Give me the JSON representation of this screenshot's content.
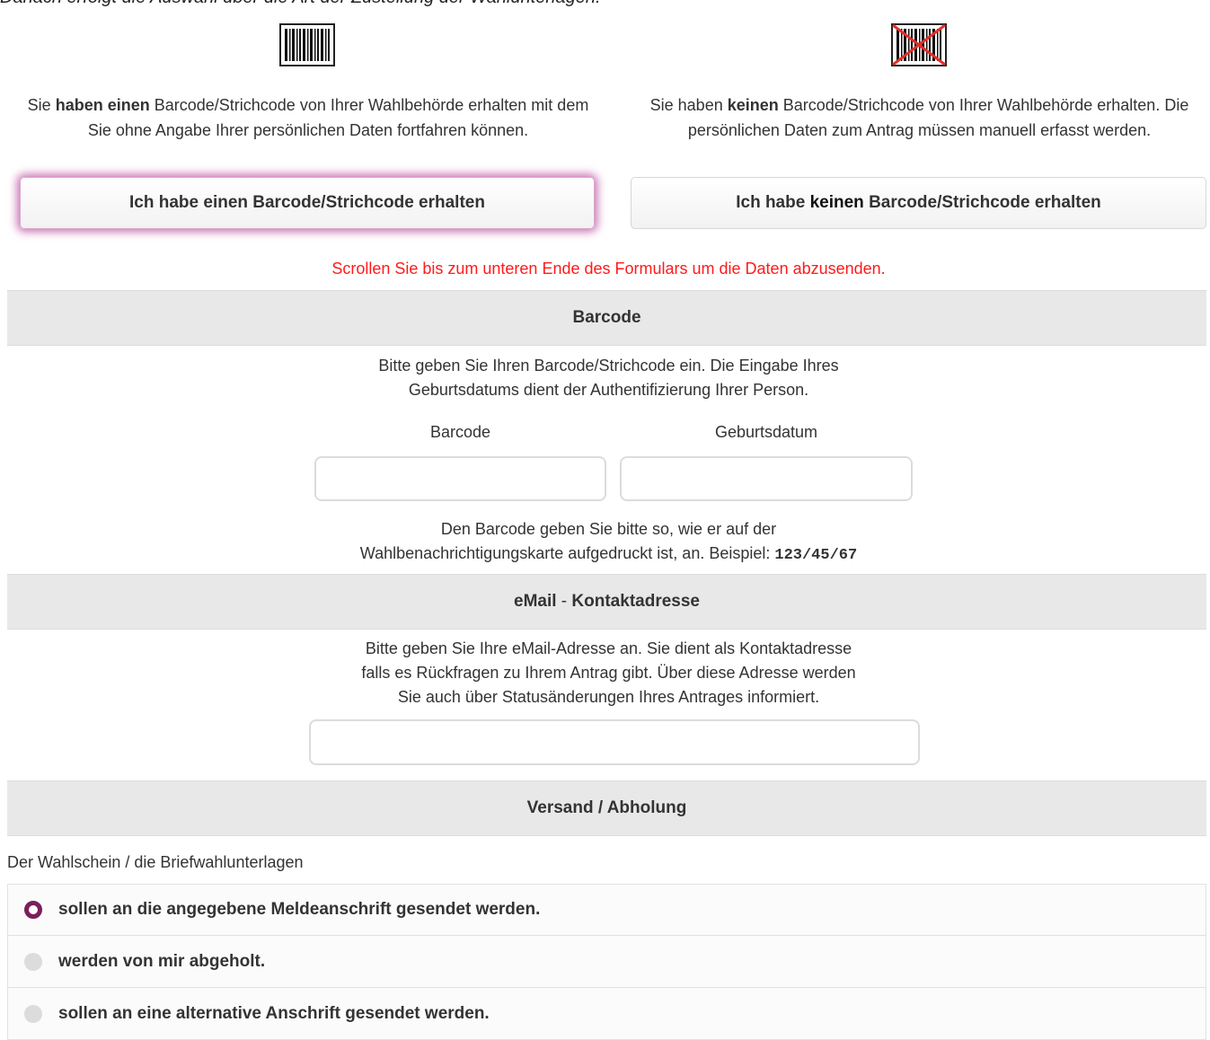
{
  "intro_text": "Danach erfolgt die Auswahl über die Art der Zustellung der Wahlunterlagen.",
  "options": {
    "with_barcode": {
      "icon": "barcode-icon",
      "desc_pre": "Sie ",
      "desc_bold": "haben einen",
      "desc_post": " Barcode/Strichcode von Ihrer Wahlbehörde erhalten mit dem Sie ohne Angabe Ihrer persönlichen Daten fortfahren können.",
      "button_label": "Ich habe einen Barcode/Strichcode erhalten"
    },
    "without_barcode": {
      "icon": "no-barcode-icon",
      "desc_pre": "Sie haben ",
      "desc_bold": "keinen",
      "desc_post": " Barcode/Strichcode von Ihrer Wahlbehörde erhalten. Die persönlichen Daten zum Antrag müssen manuell erfasst werden.",
      "button_pre": "Ich habe ",
      "button_bold": "keinen",
      "button_post": " Barcode/Strichcode erhalten"
    }
  },
  "scroll_hint": "Scrollen Sie bis zum unteren Ende des Formulars um die Daten abzusenden.",
  "barcode_section": {
    "title": "Barcode",
    "instruction_line1": "Bitte geben Sie Ihren Barcode/Strichcode ein. Die Eingabe Ihres",
    "instruction_line2": "Geburtsdatums dient der Authentifizierung Ihrer Person.",
    "barcode_label": "Barcode",
    "birthdate_label": "Geburtsdatum",
    "barcode_value": "",
    "birthdate_value": "",
    "hint_line1": "Den Barcode geben Sie bitte so, wie er auf der",
    "hint_line2": "Wahlbenachrichtigungskarte aufgedruckt ist, an. Beispiel: ",
    "example": "123/45/67"
  },
  "email_section": {
    "title_bold_a": "eMail",
    "title_thin": " - ",
    "title_bold_b": "Kontaktadresse",
    "instruction_line1": "Bitte geben Sie Ihre eMail-Adresse an. Sie dient als Kontaktadresse",
    "instruction_line2": "falls es Rückfragen zu Ihrem Antrag gibt. Über diese Adresse werden",
    "instruction_line3": "Sie auch über Statusänderungen Ihres Antrages informiert.",
    "email_value": ""
  },
  "delivery_section": {
    "title": "Versand / Abholung",
    "label": "Der Wahlschein / die Briefwahlunterlagen",
    "options": [
      {
        "label": "sollen an die angegebene Meldeanschrift gesendet werden.",
        "selected": true
      },
      {
        "label": "werden von mir abgeholt.",
        "selected": false
      },
      {
        "label": "sollen an eine alternative Anschrift gesendet werden.",
        "selected": false
      }
    ]
  },
  "colors": {
    "accent": "#7a1f5c",
    "hint_red": "#ff1a1a",
    "section_bg": "#e8e8e8"
  }
}
